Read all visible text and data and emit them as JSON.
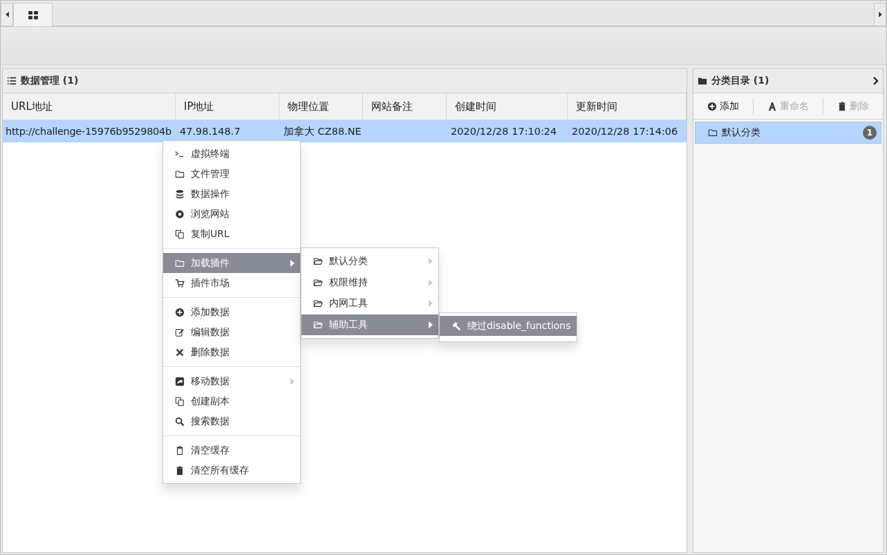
{
  "tab_bar": {
    "tabs": [
      {
        "selected": true
      }
    ]
  },
  "data_panel": {
    "title": "数据管理 (1)",
    "columns": [
      "URL地址",
      "IP地址",
      "物理位置",
      "网站备注",
      "创建时间",
      "更新时间"
    ],
    "rows": [
      {
        "url": "http://challenge-15976b9529804b",
        "ip": "47.98.148.7",
        "location": "加拿大 CZ88.NE",
        "created": "2020/12/28 17:10:24",
        "updated": "2020/12/28 17:14:06",
        "selected": true
      }
    ]
  },
  "category_panel": {
    "title": "分类目录 (1)",
    "buttons": [
      {
        "label": "添加",
        "disabled": false
      },
      {
        "label": "重命名",
        "disabled": true
      },
      {
        "label": "删除",
        "disabled": true
      }
    ],
    "items": [
      {
        "label": "默认分类",
        "count": "1",
        "selected": true
      }
    ]
  },
  "context_menu": {
    "groups": [
      [
        {
          "label": "虚拟终端",
          "submenu": false,
          "selected": false
        },
        {
          "label": "文件管理",
          "submenu": false,
          "selected": false
        },
        {
          "label": "数据操作",
          "submenu": false,
          "selected": false
        },
        {
          "label": "浏览网站",
          "submenu": false,
          "selected": false
        },
        {
          "label": "复制URL",
          "submenu": false,
          "selected": false
        }
      ],
      [
        {
          "label": "加载插件",
          "submenu": true,
          "selected": true
        },
        {
          "label": "插件市场",
          "submenu": false,
          "selected": false
        }
      ],
      [
        {
          "label": "添加数据",
          "submenu": false,
          "selected": false
        },
        {
          "label": "编辑数据",
          "submenu": false,
          "selected": false
        },
        {
          "label": "删除数据",
          "submenu": false,
          "selected": false
        }
      ],
      [
        {
          "label": "移动数据",
          "submenu": true,
          "selected": false
        },
        {
          "label": "创建副本",
          "submenu": false,
          "selected": false
        },
        {
          "label": "搜索数据",
          "submenu": false,
          "selected": false
        }
      ],
      [
        {
          "label": "清空缓存",
          "submenu": false,
          "selected": false
        },
        {
          "label": "清空所有缓存",
          "submenu": false,
          "selected": false
        }
      ]
    ]
  },
  "plugin_submenu": {
    "items": [
      {
        "label": "默认分类",
        "submenu": true,
        "selected": false
      },
      {
        "label": "权限维持",
        "submenu": true,
        "selected": false
      },
      {
        "label": "内网工具",
        "submenu": true,
        "selected": false
      },
      {
        "label": "辅助工具",
        "submenu": true,
        "selected": true
      }
    ]
  },
  "tools_submenu": {
    "items": [
      {
        "label": "绕过disable_functions",
        "selected": true
      }
    ]
  }
}
